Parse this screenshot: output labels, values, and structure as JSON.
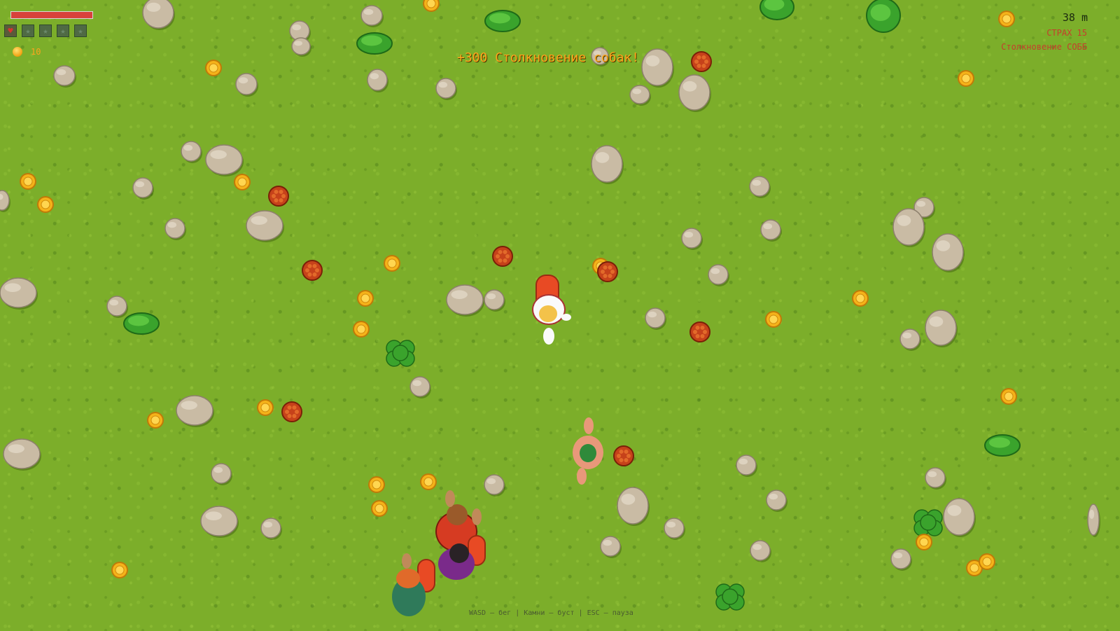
{
  "hud": {
    "health_percent": 100,
    "lives_total": 5,
    "lives_active": 1,
    "life_icon": "heart-icon",
    "coins": "10",
    "distance": "38 m",
    "fear": "СТРАХ 15",
    "collision": "Столкновение СОББ"
  },
  "event_banner": "+300 Столкновение собак!",
  "controls_hint": "WASD — бег | Камни — буст | ESC — пауза",
  "colors": {
    "grass": "#7cae2a",
    "coin": "#f5b21a",
    "health": "#d8423b",
    "hud_text_accent": "#ffa41c",
    "warning_text": "#c63d2c",
    "rock": "#c9bba4",
    "bush": "#3aa32c",
    "mine": "#c6421a"
  },
  "entities": {
    "player": {
      "name": "player-dog-on-skateboard",
      "icon": "dog-icon"
    },
    "enemies": [
      {
        "name": "chasing-dog-pink"
      },
      {
        "name": "chasing-dog-red-shirt"
      },
      {
        "name": "chasing-dog-purple-shirt"
      },
      {
        "name": "chasing-dog-green-shirt"
      }
    ]
  }
}
